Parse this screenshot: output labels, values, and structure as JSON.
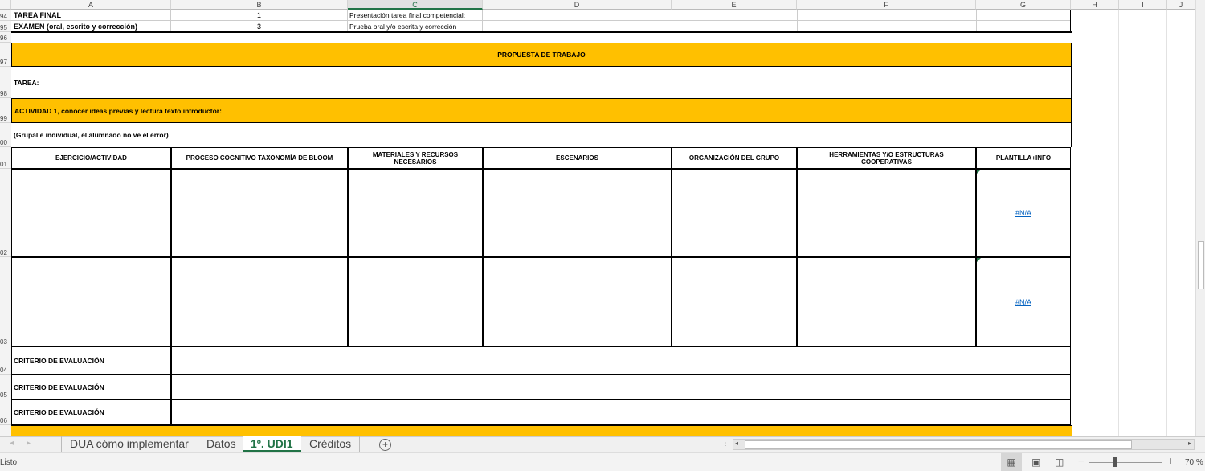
{
  "columns": [
    "A",
    "B",
    "C",
    "D",
    "E",
    "F",
    "G",
    "H",
    "I",
    "J"
  ],
  "rows": [
    "94",
    "95",
    "96",
    "97",
    "98",
    "99",
    "00",
    "01",
    "02",
    "03",
    "04",
    "05",
    "06"
  ],
  "r94": {
    "a": "TAREA FINAL",
    "b": "1",
    "c": "Presentación tarea final competencial:"
  },
  "r95": {
    "a": "EXAMEN (oral, escrito y corrección)",
    "b": "3",
    "c": "Prueba oral y/o escrita y corrección"
  },
  "propuesta": "PROPUESTA DE TRABAJO",
  "tarea": "TAREA:",
  "actividad1": "ACTIVIDAD 1, conocer ideas previas y lectura texto introductor:",
  "grupal": "(Grupal e individual, el alumnado no ve el error)",
  "headers": [
    "EJERCICIO/ACTIVIDAD",
    "PROCESO COGNITIVO TAXONOMÍA DE BLOOM",
    "MATERIALES Y RECURSOS NECESARIOS",
    "ESCENARIOS",
    "ORGANIZACIÓN DEL GRUPO",
    "HERRAMIENTAS Y/O ESTRUCTURAS COOPERATIVAS",
    "PLANTILLA+INFO"
  ],
  "na": "#N/A",
  "criterio": "CRITERIO DE EVALUACIÓN",
  "tabs": [
    "DUA cómo implementar",
    "Datos",
    "1º. UDI1",
    "Créditos"
  ],
  "status": "Listo",
  "zoom": "70 %",
  "colors": {
    "accent": "#217346",
    "yellow": "#ffc000"
  }
}
